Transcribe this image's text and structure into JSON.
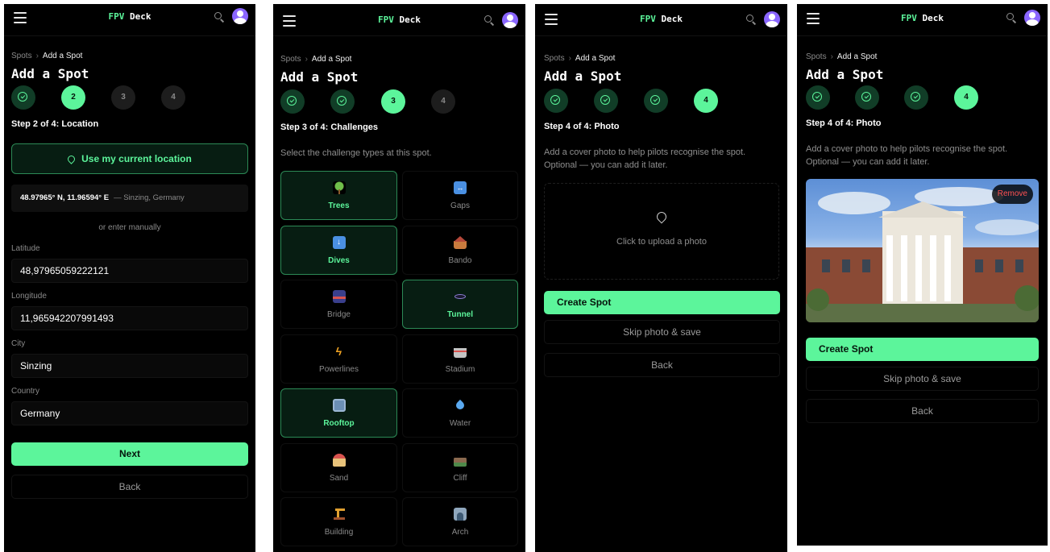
{
  "header": {
    "logo_accent": "FPV",
    "logo_rest": "Deck"
  },
  "breadcrumb": {
    "root": "Spots",
    "current": "Add a Spot"
  },
  "page_title": "Add a Spot",
  "colors": {
    "accent": "#5cf59b",
    "background": "#000000",
    "selected_bg": "#071d12",
    "danger": "#ff5252",
    "avatar": "#8a66ff"
  },
  "screen1": {
    "steps": [
      {
        "state": "done",
        "label": ""
      },
      {
        "state": "active",
        "label": "2"
      },
      {
        "state": "todo",
        "label": "3"
      },
      {
        "state": "todo",
        "label": "4"
      }
    ],
    "step_title": "Step 2 of 4: Location",
    "use_location_label": "Use my current location",
    "coords_value": "48.97965° N, 11.96594° E",
    "coords_place": "— Sinzing, Germany",
    "or_text": "or enter manually",
    "fields": [
      {
        "label": "Latitude",
        "value": "48,97965059222121"
      },
      {
        "label": "Longitude",
        "value": "11,965942207991493"
      },
      {
        "label": "City",
        "value": "Sinzing"
      },
      {
        "label": "Country",
        "value": "Germany"
      }
    ],
    "next_label": "Next",
    "back_label": "Back"
  },
  "screen2": {
    "steps": [
      {
        "state": "done",
        "label": ""
      },
      {
        "state": "done",
        "label": ""
      },
      {
        "state": "active",
        "label": "3"
      },
      {
        "state": "todo",
        "label": "4"
      }
    ],
    "step_title": "Step 3 of 4: Challenges",
    "description": "Select the challenge types at this spot.",
    "challenges": [
      {
        "label": "Trees",
        "icon": "tree-icon",
        "selected": true
      },
      {
        "label": "Gaps",
        "icon": "gap-arrows-icon",
        "selected": false
      },
      {
        "label": "Dives",
        "icon": "down-arrow-icon",
        "selected": true
      },
      {
        "label": "Bando",
        "icon": "house-icon",
        "selected": false
      },
      {
        "label": "Bridge",
        "icon": "bridge-icon",
        "selected": false
      },
      {
        "label": "Tunnel",
        "icon": "tunnel-icon",
        "selected": true
      },
      {
        "label": "Powerlines",
        "icon": "lightning-icon",
        "selected": false
      },
      {
        "label": "Stadium",
        "icon": "stadium-icon",
        "selected": false
      },
      {
        "label": "Rooftop",
        "icon": "building-icon",
        "selected": true
      },
      {
        "label": "Water",
        "icon": "droplet-icon",
        "selected": false
      },
      {
        "label": "Sand",
        "icon": "sand-icon",
        "selected": false
      },
      {
        "label": "Cliff",
        "icon": "cliff-icon",
        "selected": false
      },
      {
        "label": "Building",
        "icon": "crane-icon",
        "selected": false
      },
      {
        "label": "Arch",
        "icon": "arch-icon",
        "selected": false
      }
    ]
  },
  "screen3": {
    "steps": [
      {
        "state": "done",
        "label": ""
      },
      {
        "state": "done",
        "label": ""
      },
      {
        "state": "done",
        "label": ""
      },
      {
        "state": "active",
        "label": "4"
      }
    ],
    "step_title": "Step 4 of 4: Photo",
    "description": "Add a cover photo to help pilots recognise the spot. Optional — you can add it later.",
    "upload_label": "Click to upload a photo",
    "create_label": "Create Spot",
    "skip_label": "Skip photo & save",
    "back_label": "Back"
  },
  "screen4": {
    "steps": [
      {
        "state": "done",
        "label": ""
      },
      {
        "state": "done",
        "label": ""
      },
      {
        "state": "done",
        "label": ""
      },
      {
        "state": "active",
        "label": "4"
      }
    ],
    "step_title": "Step 4 of 4: Photo",
    "description": "Add a cover photo to help pilots recognise the spot. Optional — you can add it later.",
    "remove_label": "Remove",
    "create_label": "Create Spot",
    "skip_label": "Skip photo & save",
    "back_label": "Back"
  }
}
